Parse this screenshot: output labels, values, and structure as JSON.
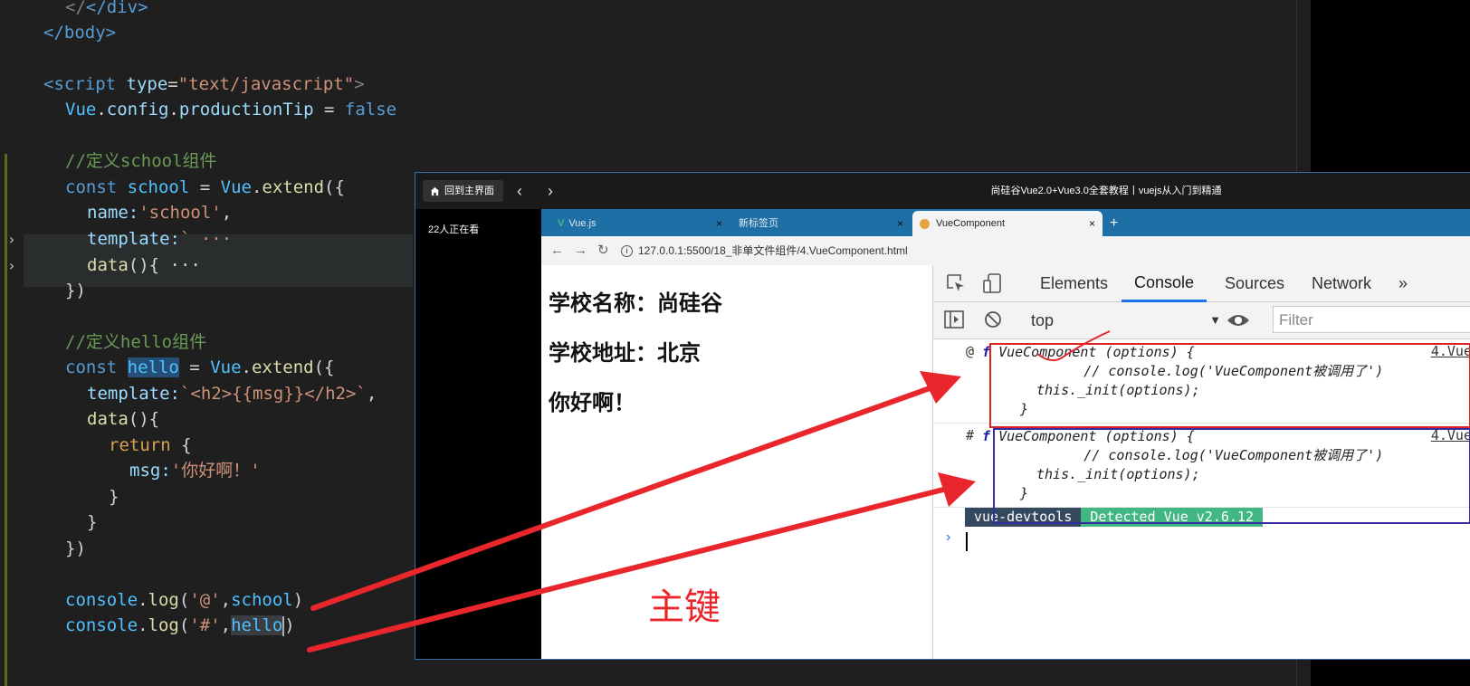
{
  "editor": {
    "lines": [
      "</div>",
      "</body>",
      "",
      "<script type=\"text/javascript\">",
      "Vue.config.productionTip = false",
      "",
      "//定义school组件",
      "const school = Vue.extend({",
      "name:'school',",
      "template:` ···",
      "data(){ ···",
      "})",
      "",
      "//定义hello组件",
      "const hello = Vue.extend({",
      "template:`<h2>{{msg}}</h2>`,",
      "data(){",
      "return {",
      "msg:'你好啊！'",
      "}",
      "}",
      "})",
      "",
      "console.log('@',school)",
      "console.log('#',hello)"
    ],
    "tokens": {
      "close_div": "</div>",
      "close_body": "</body>",
      "script_open": "<script",
      "type_attr": "type",
      "type_value": "\"text/javascript\"",
      "gt": ">",
      "vue": "Vue",
      "config": "config",
      "productionTip": "productionTip",
      "false_kw": "false",
      "comment_school": "//定义school组件",
      "const_kw": "const",
      "school_var": "school",
      "extend": "extend",
      "name_key": "name:",
      "school_str": "'school'",
      "template_key": "template:",
      "template_fold": "` ···",
      "data_fn": "data",
      "data_fold": "(){ ···",
      "comment_hello": "//定义hello组件",
      "hello_var": "hello",
      "template_str": "`<h2>{{msg}}</h2>`",
      "return_kw": "return",
      "msg_key": "msg:",
      "msg_str": "'你好啊！'",
      "console": "console",
      "log": "log",
      "at_str": "'@'",
      "hash_str": "'#'"
    },
    "fold_icon": "chevron-right-icon"
  },
  "overlay": {
    "home_button": "回到主界面",
    "title": "尚硅谷Vue2.0+Vue3.0全套教程丨vuejs从入门到精通",
    "viewers": "22人正在看"
  },
  "browser": {
    "tabs": [
      {
        "label": "Vue.js",
        "close": "×"
      },
      {
        "label": "新标签页",
        "close": "×"
      },
      {
        "label": "VueComponent",
        "close": "×"
      }
    ],
    "new_tab": "+",
    "url": "127.0.0.1:5500/18_非单文件组件/4.VueComponent.html"
  },
  "page": {
    "school_name": "学校名称：尚硅谷",
    "school_address": "学校地址：北京",
    "hello_msg": "你好啊！",
    "annotation": "主键"
  },
  "devtools": {
    "tabs": [
      "Elements",
      "Console",
      "Sources",
      "Network",
      "»"
    ],
    "active_tab": "Console",
    "context": "top",
    "filter_placeholder": "Filter",
    "entries": [
      {
        "prefix": "@",
        "line1": "VueComponent (options) {",
        "line2": "          // console.log('VueComponent被调用了')",
        "line3": "this._init(options);",
        "line4": "}",
        "source": "4.Vue"
      },
      {
        "prefix": "#",
        "line1": "VueComponent (options) {",
        "line2": "          // console.log('VueComponent被调用了')",
        "line3": "this._init(options);",
        "line4": "}",
        "source": "4.Vue"
      }
    ],
    "f_symbol": "f",
    "badge_left": "vue-devtools",
    "badge_right": "Detected Vue v2.6.12",
    "prompt": "›"
  },
  "colors": {
    "annotation_red": "#e8262b",
    "vue_green": "#41b883",
    "devtools_blue": "#1a73e8"
  }
}
